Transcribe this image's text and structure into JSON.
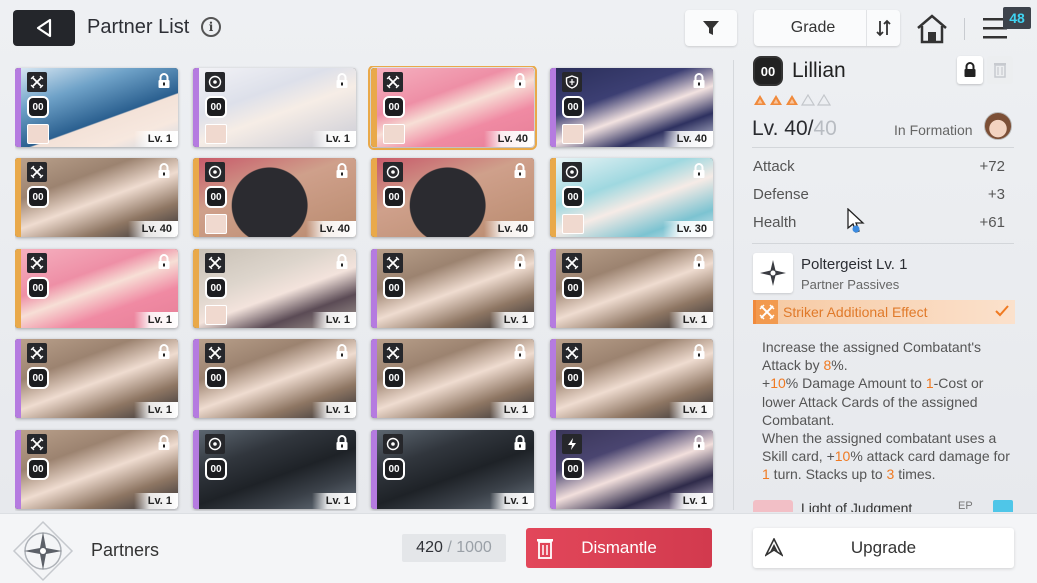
{
  "header": {
    "title": "Partner List",
    "info_icon": "i",
    "sort_label": "Grade",
    "notification_count": "48"
  },
  "cards": [
    {
      "level": "Lv. 1",
      "cost": "00",
      "class_icon": "striker-icon",
      "strip": "#b57be0",
      "art": "blue-hair",
      "mini": true,
      "selected": false
    },
    {
      "level": "Lv. 1",
      "cost": "00",
      "class_icon": "target-icon",
      "strip": "#b57be0",
      "art": "white-hair",
      "mini": true,
      "selected": false
    },
    {
      "level": "Lv. 40",
      "cost": "00",
      "class_icon": "striker-icon",
      "strip": "#e9a94a",
      "art": "pink-hair",
      "mini": true,
      "selected": true
    },
    {
      "level": "Lv. 40",
      "cost": "00",
      "class_icon": "shield-icon",
      "strip": "#b57be0",
      "art": "navy-hair",
      "mini": true,
      "selected": false
    },
    {
      "level": "Lv. 40",
      "cost": "00",
      "class_icon": "striker-icon",
      "strip": "#e9a94a",
      "art": "brown-hair",
      "mini": false,
      "selected": false
    },
    {
      "level": "Lv. 40",
      "cost": "00",
      "class_icon": "target-icon",
      "strip": "#e9a94a",
      "art": "black-blob",
      "mini": true,
      "selected": false
    },
    {
      "level": "Lv. 40",
      "cost": "00",
      "class_icon": "target-icon",
      "strip": "#e9a94a",
      "art": "black-blob",
      "mini": false,
      "selected": false
    },
    {
      "level": "Lv. 30",
      "cost": "00",
      "class_icon": "target-icon",
      "strip": "#e9a94a",
      "art": "teal-hair",
      "mini": true,
      "selected": false
    },
    {
      "level": "Lv. 1",
      "cost": "00",
      "class_icon": "striker-icon",
      "strip": "#e9a94a",
      "art": "pink-hair",
      "mini": false,
      "selected": false
    },
    {
      "level": "Lv. 1",
      "cost": "00",
      "class_icon": "striker-icon",
      "strip": "#e9a94a",
      "art": "silver-hair",
      "mini": true,
      "selected": false
    },
    {
      "level": "Lv. 1",
      "cost": "00",
      "class_icon": "striker-icon",
      "strip": "#b57be0",
      "art": "brown-hair",
      "mini": false,
      "selected": false
    },
    {
      "level": "Lv. 1",
      "cost": "00",
      "class_icon": "striker-icon",
      "strip": "#b57be0",
      "art": "brown-hair",
      "mini": false,
      "selected": false
    },
    {
      "level": "Lv. 1",
      "cost": "00",
      "class_icon": "striker-icon",
      "strip": "#b57be0",
      "art": "brown-hair",
      "mini": false,
      "selected": false
    },
    {
      "level": "Lv. 1",
      "cost": "00",
      "class_icon": "striker-icon",
      "strip": "#b57be0",
      "art": "brown-hair",
      "mini": false,
      "selected": false
    },
    {
      "level": "Lv. 1",
      "cost": "00",
      "class_icon": "striker-icon",
      "strip": "#b57be0",
      "art": "brown-hair",
      "mini": false,
      "selected": false
    },
    {
      "level": "Lv. 1",
      "cost": "00",
      "class_icon": "striker-icon",
      "strip": "#b57be0",
      "art": "brown-hair",
      "mini": false,
      "selected": false
    },
    {
      "level": "Lv. 1",
      "cost": "00",
      "class_icon": "striker-icon",
      "strip": "#b57be0",
      "art": "brown-hair",
      "mini": false,
      "selected": false
    },
    {
      "level": "Lv. 1",
      "cost": "00",
      "class_icon": "target-icon",
      "strip": "#b57be0",
      "art": "dark-machine",
      "mini": false,
      "selected": false
    },
    {
      "level": "Lv. 1",
      "cost": "00",
      "class_icon": "target-icon",
      "strip": "#b57be0",
      "art": "dark-machine",
      "mini": false,
      "selected": false
    },
    {
      "level": "Lv. 1",
      "cost": "00",
      "class_icon": "lightning-icon",
      "strip": "#b57be0",
      "art": "glasses-girl",
      "mini": false,
      "selected": false
    }
  ],
  "detail": {
    "cost": "00",
    "name": "Lillian",
    "stars_filled": 3,
    "stars_total": 5,
    "level_current": "Lv. 40/",
    "level_max": "40",
    "formation_label": "In Formation",
    "stats": [
      {
        "label": "Attack",
        "value": "+72"
      },
      {
        "label": "Defense",
        "value": "+3"
      },
      {
        "label": "Health",
        "value": "+61"
      }
    ],
    "skill_name": "Poltergeist Lv. 1",
    "skill_type": "Partner Passives",
    "effect_label": "Striker Additional Effect",
    "desc": {
      "l1a": "Increase the assigned Combatant's Attack by ",
      "l1b": "8",
      "l1c": "%.",
      "l2a": "+",
      "l2b": "10",
      "l2c": "% Damage Amount to ",
      "l2d": "1",
      "l2e": "-Cost or lower Attack Cards of the assigned Combatant.",
      "l3a": "When the assigned combatant uses a Skill card, +",
      "l3b": "10",
      "l3c": "% attack card damage for ",
      "l3d": "1",
      "l3e": " turn. Stacks up to ",
      "l3f": "3",
      "l3g": " times."
    },
    "next_skill_name": "Light of Judgment",
    "next_skill_tag": "EP"
  },
  "footer": {
    "section_label": "Partners",
    "capacity_current": "420",
    "capacity_sep": " / ",
    "capacity_max": "1000",
    "dismantle_label": "Dismantle",
    "upgrade_label": "Upgrade"
  },
  "colors": {
    "accent_orange": "#f07a22",
    "dismantle_red": "#d9404f",
    "selected_outline": "#e9a94a",
    "badge_cyan": "#3fd3f2"
  }
}
